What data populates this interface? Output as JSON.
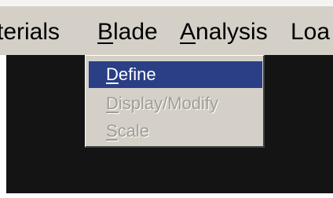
{
  "menubar": {
    "items": [
      {
        "id": "materials",
        "pre": "",
        "mnemonic": "",
        "post": "terials"
      },
      {
        "id": "blade",
        "pre": "",
        "mnemonic": "B",
        "post": "lade"
      },
      {
        "id": "analysis",
        "pre": "",
        "mnemonic": "A",
        "post": "nalysis"
      },
      {
        "id": "loads",
        "pre": "Loa",
        "mnemonic": "",
        "post": ""
      }
    ]
  },
  "dropdown": {
    "items": [
      {
        "mnemonic": "D",
        "rest": "efine",
        "state": "highlighted"
      },
      {
        "mnemonic": "D",
        "rest": "isplay/Modify",
        "state": "disabled"
      },
      {
        "mnemonic": "S",
        "rest": "cale",
        "state": "disabled"
      }
    ]
  },
  "colors": {
    "menubar_bg": "#d4d0c8",
    "highlight": "#2a3f86",
    "disabled_text": "#a09d96",
    "workspace": "#141414"
  }
}
